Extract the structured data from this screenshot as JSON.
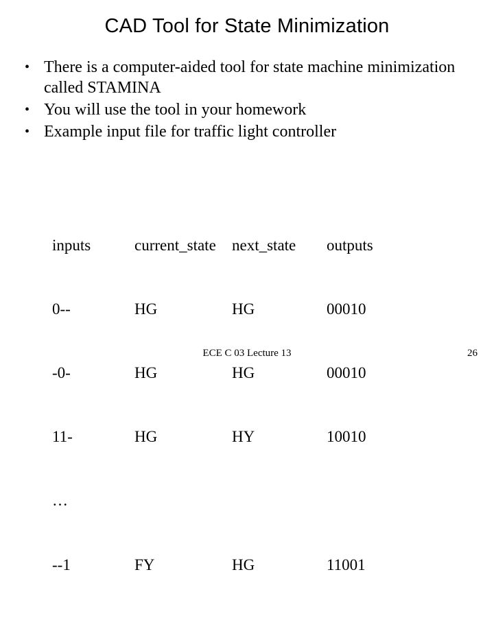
{
  "title": "CAD Tool for State Minimization",
  "bullets": [
    "There is a computer-aided tool for state machine minimization called  STAMINA",
    "You will use the tool in your homework",
    "Example input file for traffic light controller"
  ],
  "table": {
    "headers": {
      "inputs": "inputs",
      "current": "current_state",
      "next": "next_state",
      "outputs": "outputs"
    },
    "rows": [
      {
        "inputs": "0--",
        "current": "HG",
        "next": "HG",
        "outputs": "00010"
      },
      {
        "inputs": "-0-",
        "current": "HG",
        "next": "HG",
        "outputs": "00010"
      },
      {
        "inputs": "11-",
        "current": "HG",
        "next": "HY",
        "outputs": "10010"
      },
      {
        "inputs": "…",
        "current": "",
        "next": "",
        "outputs": ""
      },
      {
        "inputs": "--1",
        "current": "FY",
        "next": "HG",
        "outputs": "11001"
      }
    ]
  },
  "footer": {
    "center": "ECE C 03 Lecture 13",
    "right": "26"
  },
  "bullet_char": "•"
}
